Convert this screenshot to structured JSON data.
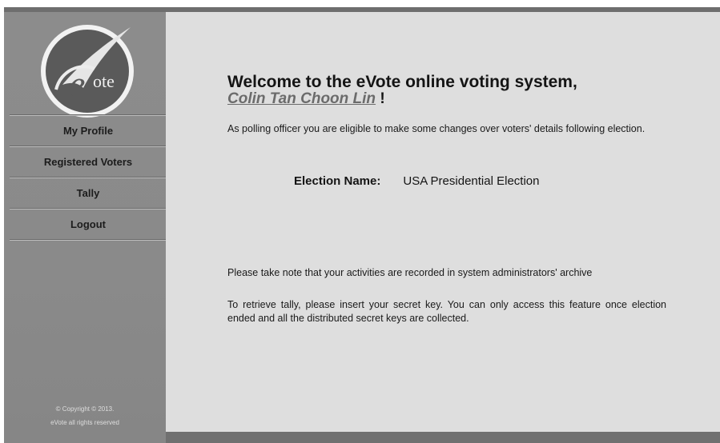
{
  "sidebar": {
    "logo_text": "ote",
    "items": [
      {
        "label": "My Profile"
      },
      {
        "label": "Registered Voters"
      },
      {
        "label": "Tally"
      },
      {
        "label": "Logout"
      }
    ],
    "copyright_line1": "© Copyright © 2013.",
    "copyright_line2": "eVote all rights reserved"
  },
  "main": {
    "welcome": "Welcome to the eVote online voting system,",
    "user_name": "Colin Tan Choon Lin",
    "user_suffix": " !",
    "intro": "As polling officer you are eligible to make some changes over voters' details following election.",
    "election_label": "Election Name:",
    "election_value": "USA Presidential Election",
    "note": "Please take note that your activities are recorded in system administrators' archive",
    "tally_info": "To retrieve tally, please insert your secret key. You can only access this feature once election ended and all the distributed secret keys are collected."
  },
  "colors": {
    "sidebar_bg": "#8a8a8a",
    "main_bg": "#dedede",
    "link": "#6b6b6b"
  }
}
